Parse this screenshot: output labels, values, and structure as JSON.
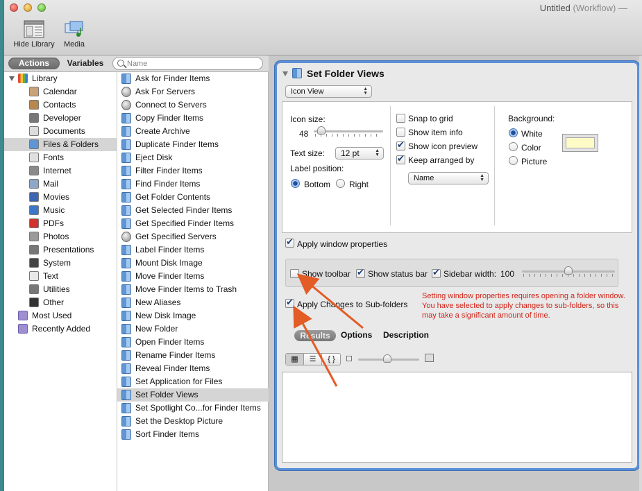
{
  "window": {
    "title": "Untitled",
    "title_sub": "(Workflow)",
    "title_suffix": "—"
  },
  "toolbar": {
    "hide_library_label": "Hide Library",
    "media_label": "Media"
  },
  "left_tabs": {
    "actions_label": "Actions",
    "variables_label": "Variables",
    "search_placeholder": "Name"
  },
  "library": {
    "root_label": "Library",
    "items": [
      {
        "label": "Calendar",
        "icon": "calendar-icon",
        "color": "#c9a27a"
      },
      {
        "label": "Contacts",
        "icon": "contacts-icon",
        "color": "#b7874d"
      },
      {
        "label": "Developer",
        "icon": "developer-icon",
        "color": "#777777"
      },
      {
        "label": "Documents",
        "icon": "documents-icon",
        "color": "#dcdcdc"
      },
      {
        "label": "Files & Folders",
        "icon": "finder-icon",
        "color": "#5e95d4"
      },
      {
        "label": "Fonts",
        "icon": "fonts-icon",
        "color": "#e0e0e0"
      },
      {
        "label": "Internet",
        "icon": "internet-icon",
        "color": "#8a8a8a"
      },
      {
        "label": "Mail",
        "icon": "mail-icon",
        "color": "#8ca8c9"
      },
      {
        "label": "Movies",
        "icon": "movies-icon",
        "color": "#3e67b3"
      },
      {
        "label": "Music",
        "icon": "music-icon",
        "color": "#3f77c8"
      },
      {
        "label": "PDFs",
        "icon": "pdf-icon",
        "color": "#d2322b"
      },
      {
        "label": "Photos",
        "icon": "photos-icon",
        "color": "#9a9a9a"
      },
      {
        "label": "Presentations",
        "icon": "presentations-icon",
        "color": "#777777"
      },
      {
        "label": "System",
        "icon": "system-icon",
        "color": "#444444"
      },
      {
        "label": "Text",
        "icon": "text-icon",
        "color": "#e8e8e8"
      },
      {
        "label": "Utilities",
        "icon": "utilities-icon",
        "color": "#777777"
      },
      {
        "label": "Other",
        "icon": "other-icon",
        "color": "#333333"
      }
    ],
    "selected_index": 4,
    "most_used_label": "Most Used",
    "recently_added_label": "Recently Added"
  },
  "actions": {
    "items": [
      {
        "label": "Ask for Finder Items",
        "icon": "finder"
      },
      {
        "label": "Ask For Servers",
        "icon": "server"
      },
      {
        "label": "Connect to Servers",
        "icon": "server"
      },
      {
        "label": "Copy Finder Items",
        "icon": "finder"
      },
      {
        "label": "Create Archive",
        "icon": "finder"
      },
      {
        "label": "Duplicate Finder Items",
        "icon": "finder"
      },
      {
        "label": "Eject Disk",
        "icon": "finder"
      },
      {
        "label": "Filter Finder Items",
        "icon": "finder"
      },
      {
        "label": "Find Finder Items",
        "icon": "finder"
      },
      {
        "label": "Get Folder Contents",
        "icon": "finder"
      },
      {
        "label": "Get Selected Finder Items",
        "icon": "finder"
      },
      {
        "label": "Get Specified Finder Items",
        "icon": "finder"
      },
      {
        "label": "Get Specified Servers",
        "icon": "server"
      },
      {
        "label": "Label Finder Items",
        "icon": "finder"
      },
      {
        "label": "Mount Disk Image",
        "icon": "finder"
      },
      {
        "label": "Move Finder Items",
        "icon": "finder"
      },
      {
        "label": "Move Finder Items to Trash",
        "icon": "finder"
      },
      {
        "label": "New Aliases",
        "icon": "finder"
      },
      {
        "label": "New Disk Image",
        "icon": "finder"
      },
      {
        "label": "New Folder",
        "icon": "finder"
      },
      {
        "label": "Open Finder Items",
        "icon": "finder"
      },
      {
        "label": "Rename Finder Items",
        "icon": "finder"
      },
      {
        "label": "Reveal Finder Items",
        "icon": "finder"
      },
      {
        "label": "Set Application for Files",
        "icon": "finder"
      },
      {
        "label": "Set Folder Views",
        "icon": "finder"
      },
      {
        "label": "Set Spotlight Co...for Finder Items",
        "icon": "finder"
      },
      {
        "label": "Set the Desktop Picture",
        "icon": "finder"
      },
      {
        "label": "Sort Finder Items",
        "icon": "finder"
      }
    ],
    "selected_index": 24
  },
  "action_card": {
    "title": "Set Folder Views",
    "view_popup": "Icon View",
    "icon_size_label": "Icon size:",
    "icon_size_value": "48",
    "icon_size_slider_fraction": 0.06,
    "text_size_label": "Text size:",
    "text_size_value": "12 pt",
    "label_position_label": "Label position:",
    "label_bottom": "Bottom",
    "label_right": "Right",
    "snap_to_grid": "Snap to grid",
    "show_item_info": "Show item info",
    "show_icon_preview": "Show icon preview",
    "keep_arranged_by": "Keep arranged by",
    "arrange_popup": "Name",
    "background_label": "Background:",
    "bg_white": "White",
    "bg_color": "Color",
    "bg_picture": "Picture",
    "bg_swatch_color": "#fffbc6",
    "apply_window_properties": "Apply window properties",
    "show_toolbar": "Show toolbar",
    "show_status_bar": "Show status bar",
    "sidebar_width_label": "Sidebar width:",
    "sidebar_width_value": "100",
    "sidebar_slider_fraction": 0.5,
    "apply_changes_sub": "Apply Changes to Sub-folders",
    "note": "Setting window properties requires opening a folder window. You have selected to apply changes to sub-folders, so this may take a significant amount of time.",
    "tabs": [
      "Results",
      "Options",
      "Description"
    ],
    "view_icons": [
      "icon-view-icon",
      "list-view-icon",
      "code-view-icon"
    ]
  },
  "colors": {
    "accent_border": "#5a8fd8",
    "annotation_arrow": "#e35b25",
    "note_text": "#d0241a"
  }
}
